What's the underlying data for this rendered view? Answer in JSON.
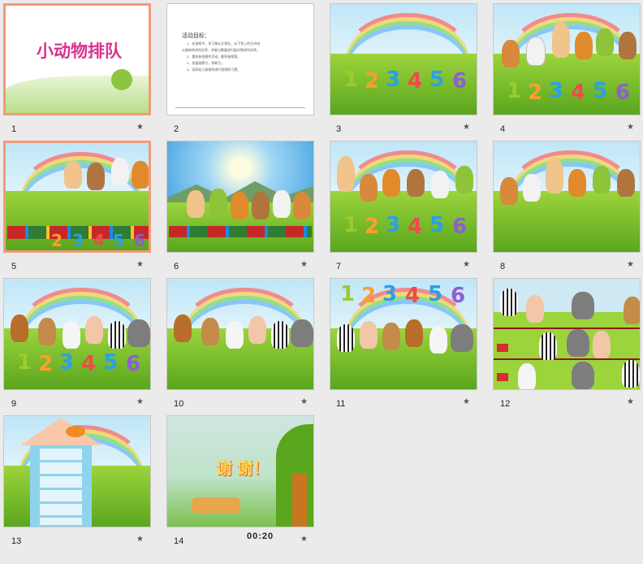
{
  "slides": [
    {
      "num": "1",
      "title": "小动物排队"
    },
    {
      "num": "2",
      "heading": "活动目标：",
      "lines": [
        "1、在游戏中，学习按从左到右，从下到上的方向给",
        "认物体的排列次序，并能与数量进行配对和排列次序。",
        "2、喜欢参加操作活动，能积极探索。",
        "3、发展观察力，判断力。",
        "4、培养幼儿按规则进行游戏的习惯。"
      ]
    },
    {
      "num": "3"
    },
    {
      "num": "4"
    },
    {
      "num": "5"
    },
    {
      "num": "6"
    },
    {
      "num": "7"
    },
    {
      "num": "8"
    },
    {
      "num": "9"
    },
    {
      "num": "10"
    },
    {
      "num": "11"
    },
    {
      "num": "12"
    },
    {
      "num": "13"
    },
    {
      "num": "14",
      "thanks": "谢 谢！"
    }
  ],
  "digits": [
    "1",
    "2",
    "3",
    "4",
    "5",
    "6"
  ],
  "timer": "00:20",
  "star_icon": "star-icon"
}
